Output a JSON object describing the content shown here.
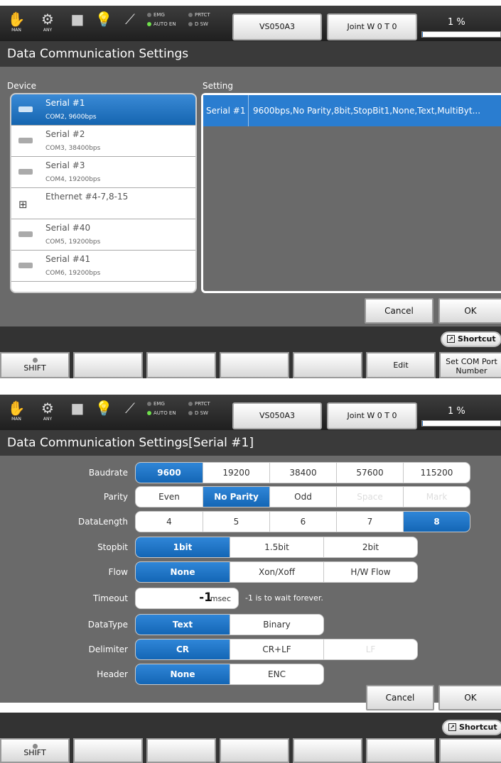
{
  "topbar": {
    "mode_man": "MAN",
    "mode_any": "ANY",
    "led_emg": "EMG",
    "led_prtct": "PRTCT",
    "led_auto_en": "AUTO EN",
    "led_dsw": "D SW",
    "robot_button": "VS050A3",
    "joint_button": "Joint W 0 T 0",
    "speed": "1 %",
    "speed_fraction": 0.01
  },
  "screen1": {
    "title": "Data Communication Settings",
    "device_header": "Device",
    "setting_header": "Setting",
    "devices": [
      {
        "name": "Serial #1",
        "sub": "COM2, 9600bps",
        "icon": "serial-port-icon",
        "selected": true
      },
      {
        "name": "Serial #2",
        "sub": "COM3, 38400bps",
        "icon": "serial-port-icon",
        "selected": false
      },
      {
        "name": "Serial #3",
        "sub": "COM4, 19200bps",
        "icon": "serial-port-icon",
        "selected": false
      },
      {
        "name": "Ethernet #4-7,8-15",
        "sub": "",
        "icon": "network-icon",
        "selected": false
      },
      {
        "name": "Serial #40",
        "sub": "COM5, 19200bps",
        "icon": "serial-port-icon",
        "selected": false
      },
      {
        "name": "Serial #41",
        "sub": "COM6, 19200bps",
        "icon": "serial-port-icon",
        "selected": false
      }
    ],
    "setting_row": {
      "key": "Serial #1",
      "value": "9600bps,No Parity,8bit,StopBit1,None,Text,MultiByt..."
    },
    "cancel": "Cancel",
    "ok": "OK",
    "shortcut": "Shortcut",
    "fkeys": [
      "SHIFT",
      "",
      "",
      "",
      "",
      "Edit",
      "Set COM Port Number"
    ]
  },
  "screen2": {
    "title": "Data Communication Settings[Serial #1]",
    "rows": [
      {
        "label": "Baudrate",
        "options": [
          {
            "text": "9600",
            "state": "on"
          },
          {
            "text": "19200",
            "state": ""
          },
          {
            "text": "38400",
            "state": ""
          },
          {
            "text": "57600",
            "state": ""
          },
          {
            "text": "115200",
            "state": ""
          }
        ]
      },
      {
        "label": "Parity",
        "options": [
          {
            "text": "Even",
            "state": ""
          },
          {
            "text": "No Parity",
            "state": "on"
          },
          {
            "text": "Odd",
            "state": ""
          },
          {
            "text": "Space",
            "state": "dis"
          },
          {
            "text": "Mark",
            "state": "dis"
          }
        ]
      },
      {
        "label": "DataLength",
        "options": [
          {
            "text": "4",
            "state": ""
          },
          {
            "text": "5",
            "state": ""
          },
          {
            "text": "6",
            "state": ""
          },
          {
            "text": "7",
            "state": ""
          },
          {
            "text": "8",
            "state": "on"
          }
        ]
      },
      {
        "label": "Stopbit",
        "options": [
          {
            "text": "1bit",
            "state": "on"
          },
          {
            "text": "1.5bit",
            "state": ""
          },
          {
            "text": "2bit",
            "state": ""
          }
        ]
      },
      {
        "label": "Flow",
        "options": [
          {
            "text": "None",
            "state": "on"
          },
          {
            "text": "Xon/Xoff",
            "state": ""
          },
          {
            "text": "H/W Flow",
            "state": ""
          }
        ]
      },
      {
        "label": "Timeout",
        "value": "-1",
        "unit": "msec",
        "note": "-1 is to wait forever."
      },
      {
        "label": "DataType",
        "options": [
          {
            "text": "Text",
            "state": "on"
          },
          {
            "text": "Binary",
            "state": ""
          }
        ]
      },
      {
        "label": "Delimiter",
        "options": [
          {
            "text": "CR",
            "state": "on"
          },
          {
            "text": "CR+LF",
            "state": ""
          },
          {
            "text": "LF",
            "state": "dis"
          }
        ]
      },
      {
        "label": "Header",
        "options": [
          {
            "text": "None",
            "state": "on"
          },
          {
            "text": "ENC",
            "state": ""
          }
        ]
      }
    ],
    "cancel": "Cancel",
    "ok": "OK",
    "shortcut": "Shortcut",
    "fkeys": [
      "SHIFT",
      "",
      "",
      "",
      "",
      "",
      ""
    ]
  },
  "colors": {
    "accent": "#1a6fc2",
    "panel": "#6a6a6a",
    "titlebar": "#3a3a3a"
  }
}
